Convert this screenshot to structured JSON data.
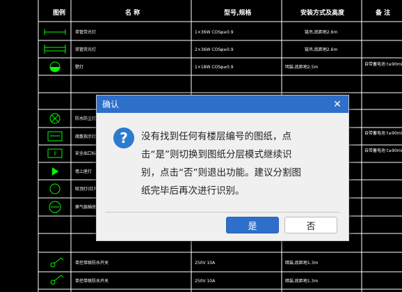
{
  "table": {
    "headers": [
      "图例",
      "名 称",
      "型号,规格",
      "安装方式及高度",
      "备 注"
    ],
    "rows": [
      {
        "name": "单管荧光灯",
        "spec": "1×36W COSφ≥0.9",
        "mount": "链吊,底距地2.6m",
        "note": ""
      },
      {
        "name": "双管荧光灯",
        "spec": "2×36W COSφ≥0.9",
        "mount": "链吊,底距地2.6m",
        "note": ""
      },
      {
        "name": "壁灯",
        "spec": "1×18W COSφ≥0.9",
        "mount": "明装,底距地2.5m",
        "note": "自带蓄电池 t≥90min"
      },
      {
        "name": "",
        "spec": "",
        "mount": "",
        "note": ""
      },
      {
        "name": "",
        "spec": "",
        "mount": "",
        "note": ""
      },
      {
        "name": "防水防尘灯",
        "spec": "",
        "mount": "",
        "note": ""
      },
      {
        "name": "疏散指示灯",
        "spec": "",
        "mount": "",
        "note": "自带蓄电池 t≥90min"
      },
      {
        "name": "安全出口标志灯",
        "spec": "",
        "mount": "",
        "note": "自带蓄电池 t≥90min"
      },
      {
        "name": "墙上座灯",
        "spec": "",
        "mount": "",
        "note": ""
      },
      {
        "name": "吸顶灯(红外)",
        "spec": "",
        "mount": "",
        "note": ""
      },
      {
        "name": "换气扇插座",
        "spec": "",
        "mount": "",
        "note": ""
      },
      {
        "name": "",
        "spec": "",
        "mount": "",
        "note": ""
      },
      {
        "name": "",
        "spec": "",
        "mount": "",
        "note": ""
      },
      {
        "name": "单控单联防水开关",
        "spec": "250V 10A",
        "mount": "暗装,底距地1.3m",
        "note": ""
      },
      {
        "name": "单控单联防水开关",
        "spec": "250V 10A",
        "mount": "暗装,底距地1.3m",
        "note": ""
      }
    ]
  },
  "dialog": {
    "title": "确认",
    "close_icon": "close-icon",
    "question_icon": "question-icon",
    "question_mark": "?",
    "message_lines": [
      "没有找到任何有楼层编号的图纸，点",
      "击“是”则切换到图纸分层模式继续识",
      "别，点击“否”则退出功能。建议分割图",
      "纸完毕后再次进行识别。"
    ],
    "yes_label": "是",
    "no_label": "否"
  }
}
